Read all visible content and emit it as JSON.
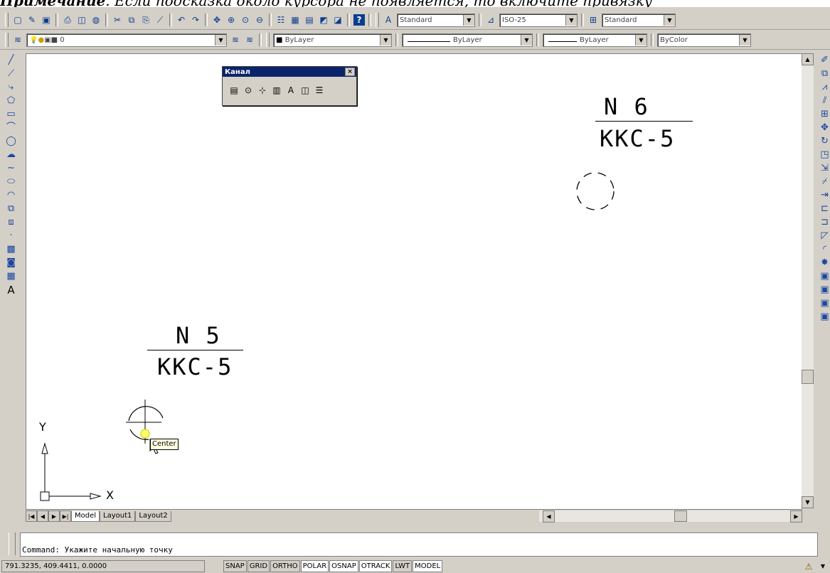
{
  "caption": {
    "bold": "Примечание",
    "text": ". Если подсказка около курсора не появляется, то включите привязку"
  },
  "toolbar1": {
    "text_style": "Standard",
    "dim_style": "ISO-25",
    "table_style": "Standard"
  },
  "toolbar2": {
    "layer": "0",
    "color": "ByLayer",
    "linetype": "ByLayer",
    "lineweight": "ByLayer",
    "plotstyle": "ByColor"
  },
  "floating_toolbar": {
    "title": "Канал",
    "close": "×"
  },
  "drawing": {
    "label1_top": "N 6",
    "label1_bottom": "KKC-5",
    "label2_top": "N 5",
    "label2_bottom": "KKC-5",
    "tooltip": "Center",
    "ucs_x": "X",
    "ucs_y": "Y"
  },
  "tabs": [
    "Model",
    "Layout1",
    "Layout2"
  ],
  "command_line": "Command: Укажите начальную точку",
  "status": {
    "coords": "791.3235, 409.4411, 0.0000",
    "buttons": [
      "SNAP",
      "GRID",
      "ORTHO",
      "POLAR",
      "OSNAP",
      "OTRACK",
      "LWT",
      "MODEL"
    ]
  }
}
